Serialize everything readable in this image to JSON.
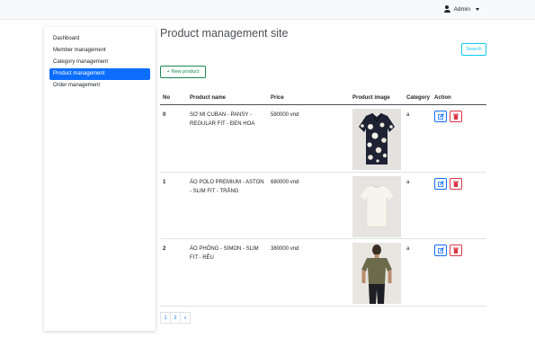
{
  "header": {
    "user_label": "Admin",
    "user_icon": "user-icon",
    "menu_icon": "caret-down-icon"
  },
  "sidebar": {
    "items": [
      {
        "label": "Dashboard",
        "active": false
      },
      {
        "label": "Member management",
        "active": false
      },
      {
        "label": "Category management",
        "active": false
      },
      {
        "label": "Product management",
        "active": true
      },
      {
        "label": "Order management",
        "active": false
      }
    ]
  },
  "main": {
    "title": "Product management site",
    "search_label": "Search",
    "new_product_label": "New product",
    "new_product_icon": "plus-icon",
    "table": {
      "columns": [
        "No",
        "Product name",
        "Price",
        "Product image",
        "Category",
        "Action"
      ],
      "rows": [
        {
          "no": "0",
          "name": "SƠ MI CUBAN - PANSY - REGULAR FIT - ĐEN HOA",
          "price": "580000 vnd",
          "image": "floral-shirt-image",
          "category": "a"
        },
        {
          "no": "1",
          "name": "ÁO POLO PREMIUM - ASTON - SLIM FIT - TRẮNG",
          "price": "680000 vnd",
          "image": "white-tshirt-image",
          "category": "a"
        },
        {
          "no": "2",
          "name": "ÁO PHÔNG - SIMON - SLIM FIT - RÊU",
          "price": "380000 vnd",
          "image": "olive-tshirt-model-image",
          "category": "a"
        }
      ],
      "edit_icon": "edit-icon",
      "delete_icon": "trash-icon"
    },
    "pagination": [
      "1",
      "2",
      "»"
    ]
  },
  "colors": {
    "primary": "#0d6efd",
    "success": "#198754",
    "danger": "#dc3545",
    "info": "#0dcaf0"
  }
}
